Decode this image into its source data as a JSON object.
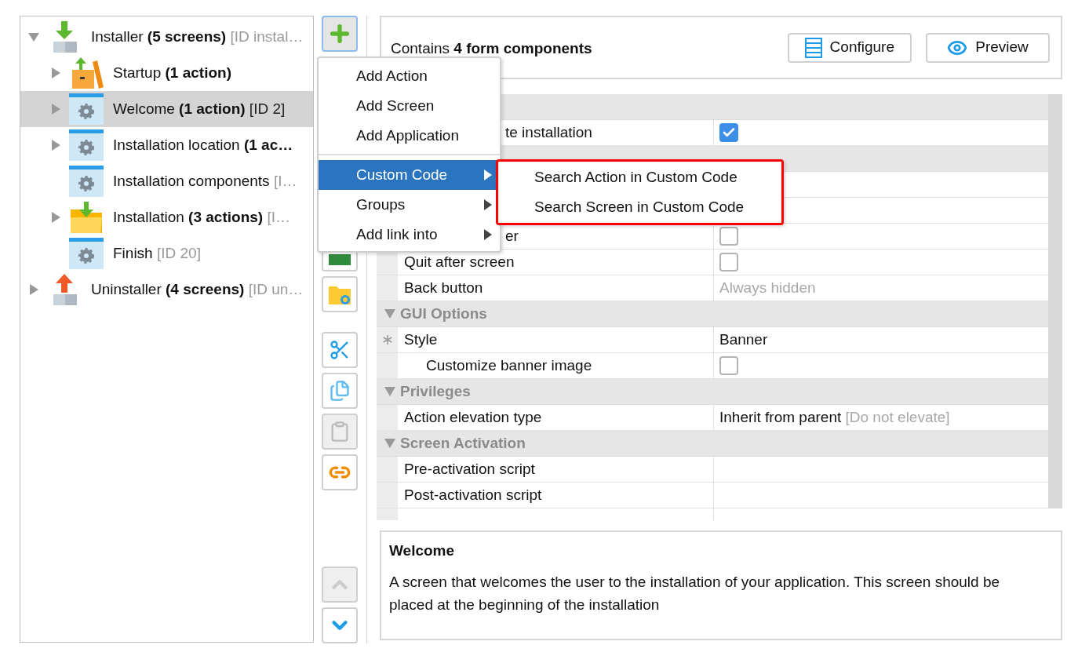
{
  "tree": [
    {
      "label": "Installer",
      "count": "(5 screens)",
      "id": "[ID instal…",
      "kind": "installer",
      "expanded": true,
      "selected": false,
      "children": [
        {
          "label": "Startup",
          "count": "(1 action)",
          "kind": "startup",
          "expanded": false,
          "selected": false
        },
        {
          "label": "Welcome",
          "count": "(1 action)",
          "id": "[ID 2]",
          "kind": "screen",
          "expanded": false,
          "selected": true
        },
        {
          "label": "Installation location",
          "count": "(1 ac…",
          "kind": "screen",
          "expanded": false,
          "selected": false
        },
        {
          "label": "Installation components",
          "id": "[I…",
          "kind": "screen",
          "selected": false
        },
        {
          "label": "Installation",
          "count": "(3 actions)",
          "id": "[I…",
          "kind": "folder",
          "expanded": false,
          "selected": false
        },
        {
          "label": "Finish",
          "id": "[ID 20]",
          "kind": "screen",
          "selected": false
        }
      ]
    },
    {
      "label": "Uninstaller",
      "count": "(4 screens)",
      "id": "[ID un…",
      "kind": "uninstaller",
      "expanded": false,
      "selected": false
    }
  ],
  "toolbar": {
    "groups": [
      [
        {
          "kind": "add",
          "selected": true,
          "disabled": false
        }
      ],
      [
        {
          "kind": "sheet",
          "selected": false,
          "disabled": false
        },
        {
          "kind": "folder",
          "selected": false,
          "disabled": false
        }
      ],
      [
        {
          "kind": "cut",
          "selected": false,
          "disabled": false
        },
        {
          "kind": "copy",
          "selected": false,
          "disabled": false
        },
        {
          "kind": "paste",
          "selected": false,
          "disabled": true
        },
        {
          "kind": "link",
          "selected": false,
          "disabled": false
        }
      ]
    ],
    "bottom": [
      {
        "kind": "up",
        "selected": false,
        "disabled": true
      },
      {
        "kind": "down",
        "selected": false,
        "disabled": false
      }
    ]
  },
  "summary": {
    "text": "Contains **4 form components**",
    "buttons": [
      {
        "label": "Configure",
        "kind": "configure"
      },
      {
        "label": "Preview",
        "kind": "preview"
      }
    ]
  },
  "grid": {
    "rows": [
      {
        "kind": "section"
      },
      {
        "kind": "check",
        "label": "te installation",
        "checked": true,
        "covered": true
      },
      {
        "kind": "section"
      },
      {
        "kind": "blank"
      },
      {
        "kind": "blank"
      },
      {
        "kind": "check",
        "label": "er",
        "checked": false,
        "covered": true
      },
      {
        "kind": "check",
        "label": "Quit after screen",
        "checked": false
      },
      {
        "kind": "text",
        "label": "Back button",
        "value": "Always hidden",
        "dimmed": true
      },
      {
        "kind": "section",
        "title": "GUI Options",
        "expanded": true
      },
      {
        "kind": "text",
        "label": "Style",
        "value": "Banner",
        "required": true,
        "children": [
          {
            "kind": "check",
            "label": "Customize banner image",
            "checked": false
          }
        ]
      },
      {
        "kind": "section",
        "title": "Privileges",
        "expanded": true
      },
      {
        "kind": "text",
        "label": "Action elevation type",
        "value": "Inherit from parent",
        "note": "[Do not elevate]"
      },
      {
        "kind": "section",
        "title": "Screen Activation",
        "expanded": true
      },
      {
        "kind": "text",
        "label": "Pre-activation script"
      },
      {
        "kind": "text",
        "label": "Post-activation script"
      },
      {
        "kind": "blank"
      }
    ]
  },
  "description": {
    "title": "Welcome",
    "text": "A screen that welcomes the user to the installation of your application. This screen should be placed at the beginning of the installation"
  },
  "menu": {
    "groups": [
      [
        {
          "label": "Add Action",
          "submenu": false,
          "selected": false
        },
        {
          "label": "Add Screen",
          "submenu": false,
          "selected": false
        },
        {
          "label": "Add Application",
          "submenu": false,
          "selected": false
        }
      ],
      [
        {
          "label": "Custom Code",
          "submenu": true,
          "selected": true
        },
        {
          "label": "Groups",
          "submenu": true,
          "selected": false
        },
        {
          "label": "Add link into",
          "submenu": true,
          "selected": false
        }
      ]
    ],
    "submenu": {
      "highlighted": true,
      "items": [
        "Search Action in Custom Code",
        "Search Screen in Custom Code"
      ]
    }
  }
}
